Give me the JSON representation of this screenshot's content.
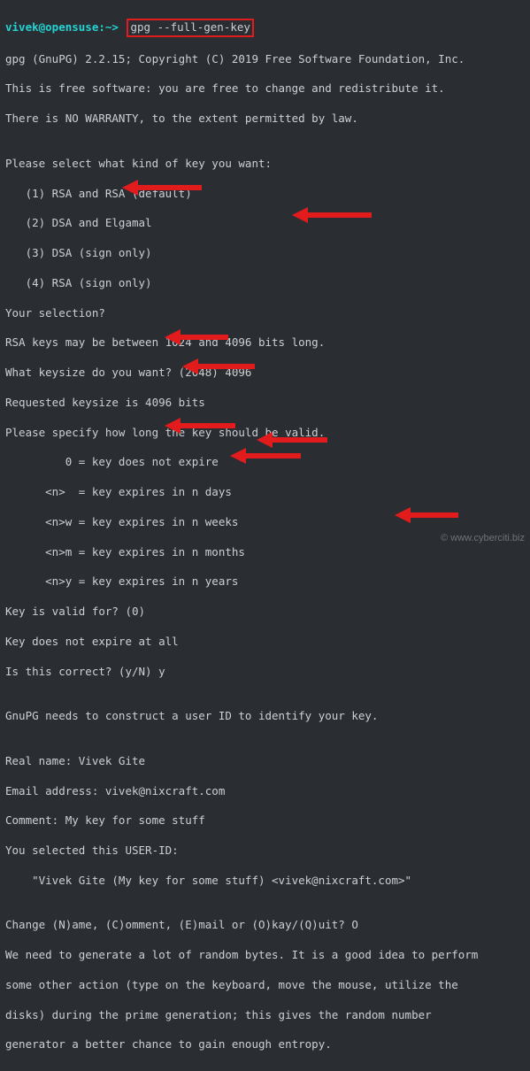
{
  "prompt": {
    "user": "vivek@opensuse",
    "path": ":~>",
    "command": "gpg --full-gen-key"
  },
  "lines": {
    "l01": "gpg (GnuPG) 2.2.15; Copyright (C) 2019 Free Software Foundation, Inc.",
    "l02": "This is free software: you are free to change and redistribute it.",
    "l03": "There is NO WARRANTY, to the extent permitted by law.",
    "l04": "",
    "l05": "Please select what kind of key you want:",
    "l06": "   (1) RSA and RSA (default)",
    "l07": "   (2) DSA and Elgamal",
    "l08": "   (3) DSA (sign only)",
    "l09": "   (4) RSA (sign only)",
    "l10": "Your selection?",
    "l11": "RSA keys may be between 1024 and 4096 bits long.",
    "l12": "What keysize do you want? (2048) 4096",
    "l13": "Requested keysize is 4096 bits",
    "l14": "Please specify how long the key should be valid.",
    "l15": "         0 = key does not expire",
    "l16": "      <n>  = key expires in n days",
    "l17": "      <n>w = key expires in n weeks",
    "l18": "      <n>m = key expires in n months",
    "l19": "      <n>y = key expires in n years",
    "l20": "Key is valid for? (0)",
    "l21": "Key does not expire at all",
    "l22": "Is this correct? (y/N) y",
    "l23": "",
    "l24": "GnuPG needs to construct a user ID to identify your key.",
    "l25": "",
    "l26": "Real name: Vivek Gite",
    "l27": "Email address: vivek@nixcraft.com",
    "l28": "Comment: My key for some stuff",
    "l29": "You selected this USER-ID:",
    "l30": "    \"Vivek Gite (My key for some stuff) <vivek@nixcraft.com>\"",
    "l31": "",
    "l32": "Change (N)ame, (C)omment, (E)mail or (O)kay/(Q)uit? O",
    "l33": "We need to generate a lot of random bytes. It is a good idea to perform",
    "l34": "some other action (type on the keyboard, move the mouse, utilize the",
    "l35": "disks) during the prime generation; this gives the random number",
    "l36": "generator a better chance to gain enough entropy."
  },
  "watermark": "© www.cyberciti.biz",
  "arrows": {
    "color": "#e21c1c"
  }
}
